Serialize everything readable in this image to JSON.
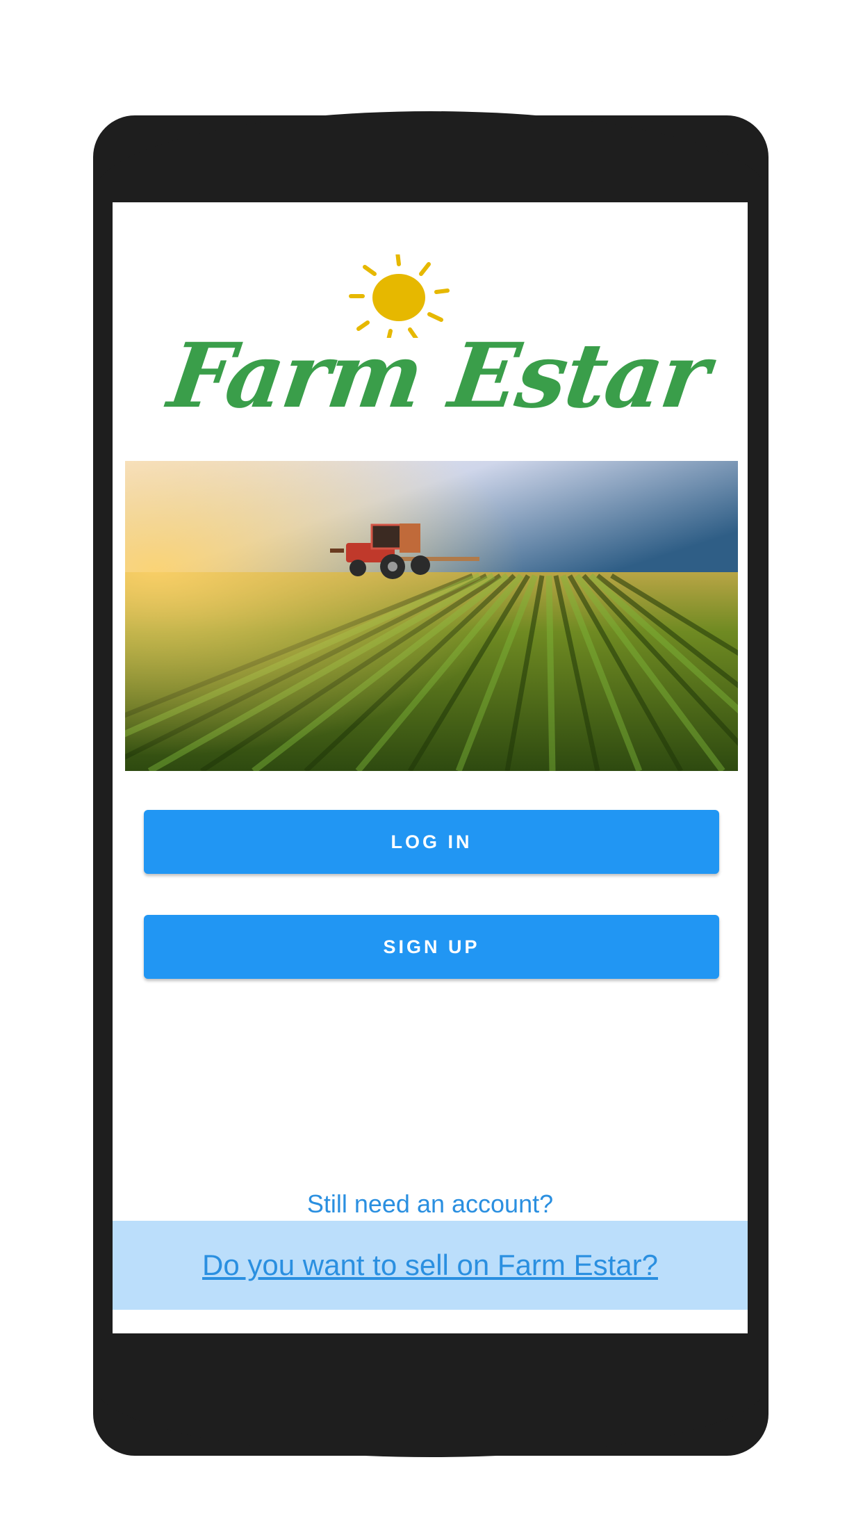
{
  "app": {
    "brand_name": "Farm Estar",
    "colors": {
      "accent": "#2196f3",
      "link": "#2a8fe0",
      "band": "#bbdefb",
      "logo_green": "#3a9e4a",
      "logo_sun": "#e6b800",
      "frame": "#1e1e1e"
    }
  },
  "logo": {
    "icon": "sun-icon",
    "wordmark": "Farm Estar"
  },
  "hero": {
    "subject": "tractor-field-image"
  },
  "actions": {
    "login_label": "LOG IN",
    "signup_label": "SIGN UP"
  },
  "footer": {
    "prompt": "Still need an account?",
    "sell_link": "Do you want to sell on Farm Estar?"
  }
}
